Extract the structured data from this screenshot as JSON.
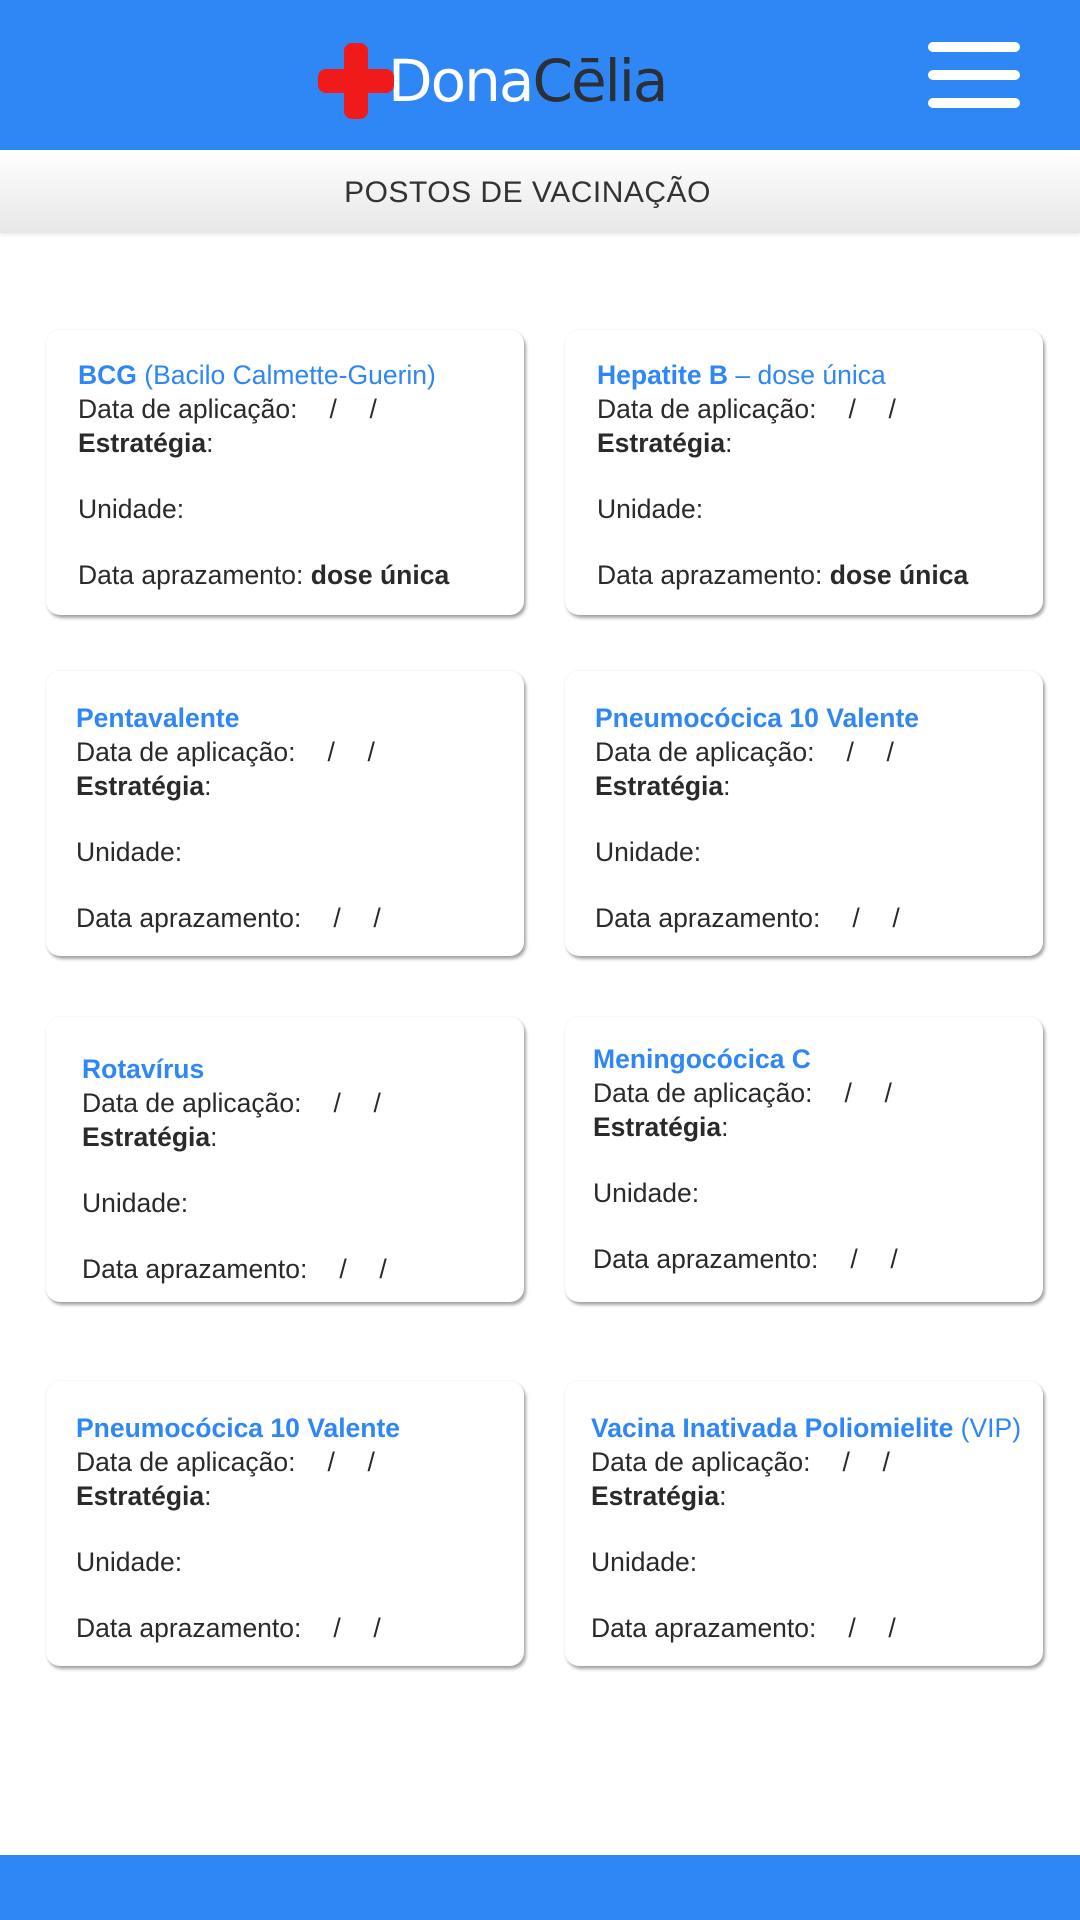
{
  "header": {
    "brand_left": "Dona",
    "brand_right": "Cēlia",
    "logo_icon": "red-cross-icon",
    "menu_icon": "hamburger-menu-icon",
    "colors": {
      "primary": "#2e87f5",
      "cross": "#f01a1a"
    }
  },
  "page": {
    "title": "POSTOS DE VACINAÇÃO"
  },
  "labels": {
    "data_aplicacao": "Data de aplicação:",
    "estrategia": "Estratégia",
    "estrategia_colon": ":",
    "unidade": "Unidade:",
    "data_aprazamento": "Data aprazamento:",
    "slash": "/"
  },
  "cards": [
    {
      "title_bold": "BCG",
      "title_rest": " (Bacilo Calmette-Guerin)",
      "aprazamento_value": "dose única"
    },
    {
      "title_bold": "Hepatite B",
      "title_rest": " – dose única",
      "aprazamento_value": "dose única"
    },
    {
      "title_bold": "Pentavalente",
      "title_rest": "",
      "aprazamento_value": ""
    },
    {
      "title_bold": "Pneumocócica 10 Valente",
      "title_rest": "",
      "aprazamento_value": ""
    },
    {
      "title_bold": "Rotavírus",
      "title_rest": "",
      "aprazamento_value": ""
    },
    {
      "title_bold": "Meningocócica C",
      "title_rest": "",
      "aprazamento_value": ""
    },
    {
      "title_bold": "Pneumocócica 10 Valente",
      "title_rest": "",
      "aprazamento_value": ""
    },
    {
      "title_bold": "Vacina Inativada Poliomielite",
      "title_rest": " (VIP)",
      "aprazamento_value": ""
    }
  ]
}
